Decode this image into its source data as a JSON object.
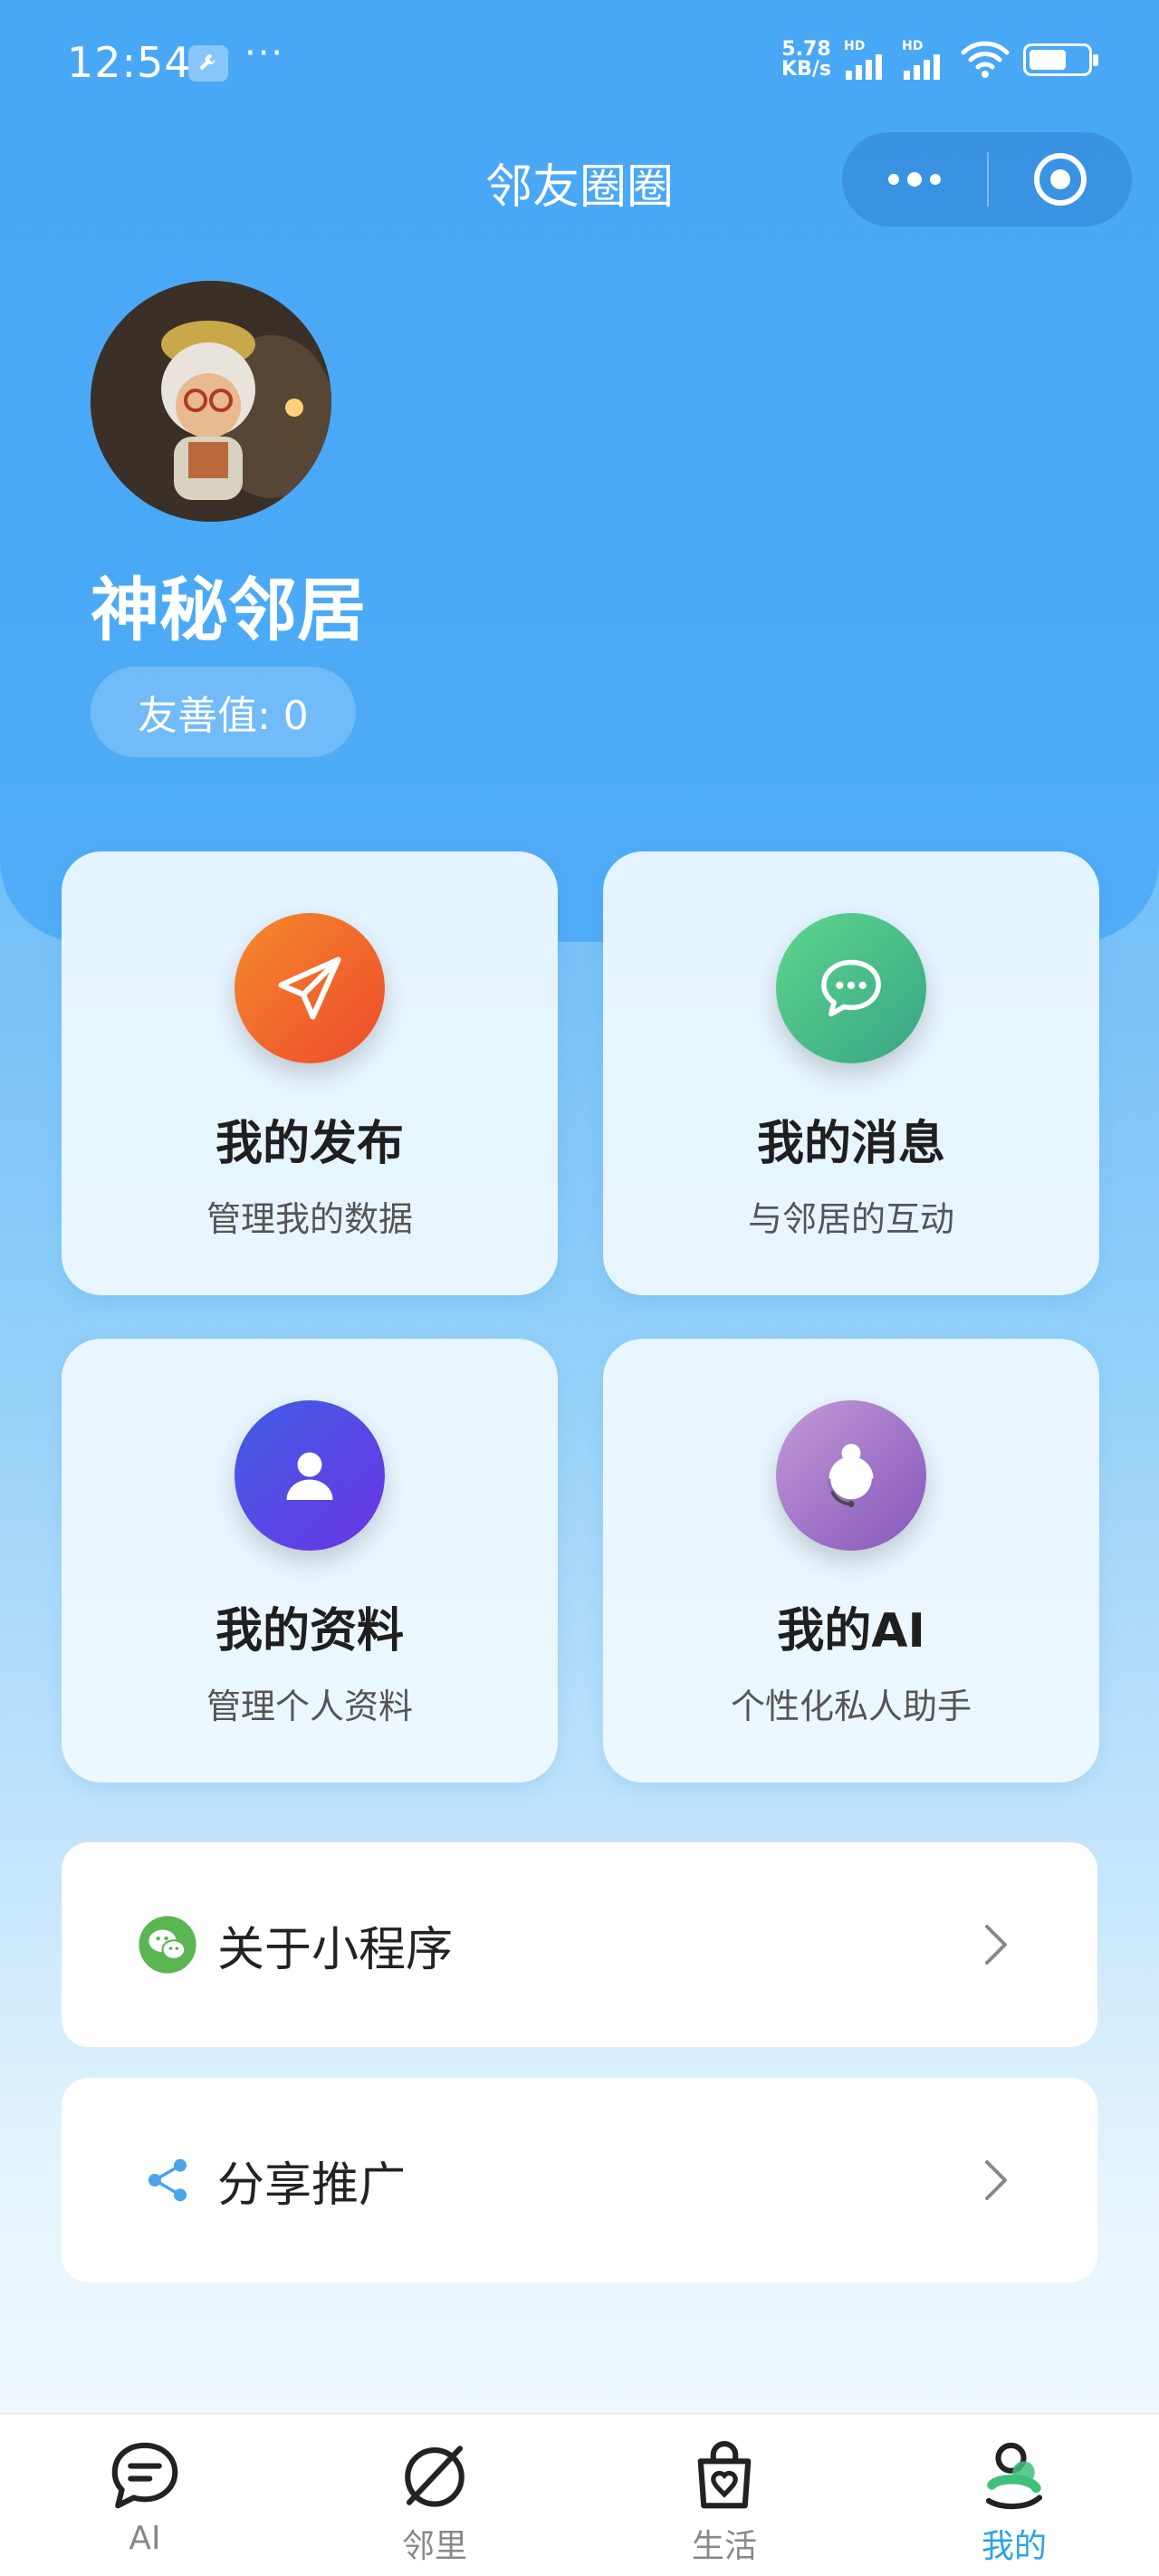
{
  "status_bar": {
    "time": "12:54",
    "dots": "···",
    "net_speed_value": "5.78",
    "net_speed_unit": "KB/s",
    "signal_1_label": "HD",
    "signal_2_label": "HD",
    "battery_level": 0.65
  },
  "nav": {
    "title": "邻友圈圈"
  },
  "profile": {
    "username": "神秘邻居",
    "kindness": "友善值: 0"
  },
  "cards": [
    {
      "title": "我的发布",
      "subtitle": "管理我的数据",
      "icon": "paper-plane-icon",
      "color_from": "#f07a2a",
      "color_to": "#ee4a2c"
    },
    {
      "title": "我的消息",
      "subtitle": "与邻居的互动",
      "icon": "chat-bubble-icon",
      "color_from": "#5bd08a",
      "color_to": "#3aa987"
    },
    {
      "title": "我的资料",
      "subtitle": "管理个人资料",
      "icon": "person-icon",
      "color_from": "#4a52e0",
      "color_to": "#6a3ae6"
    },
    {
      "title": "我的AI",
      "subtitle": "个性化私人助手",
      "icon": "assistant-icon",
      "color_from": "#b488d0",
      "color_to": "#8a5cc0"
    }
  ],
  "list": [
    {
      "label": "关于小程序",
      "icon": "wechat-icon"
    },
    {
      "label": "分享推广",
      "icon": "share-icon"
    }
  ],
  "tabs": [
    {
      "label": "AI",
      "icon": "chat-icon",
      "active": false
    },
    {
      "label": "邻里",
      "icon": "compass-icon",
      "active": false
    },
    {
      "label": "生活",
      "icon": "shopping-bag-icon",
      "active": false
    },
    {
      "label": "我的",
      "icon": "me-icon",
      "active": true
    }
  ],
  "colors": {
    "header": "#49a8f6",
    "tab_active": "#29a3e6",
    "tab_inactive": "#888888"
  }
}
